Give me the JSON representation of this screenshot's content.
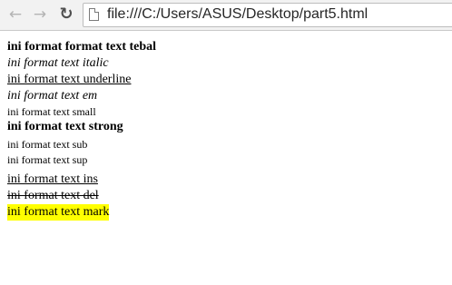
{
  "browser": {
    "back_icon": "arrow-left-icon",
    "forward_icon": "arrow-right-icon",
    "reload_icon": "reload-icon",
    "page_icon": "page-icon",
    "url": "file:///C:/Users/ASUS/Desktop/part5.html"
  },
  "page": {
    "lines": [
      {
        "text": "ini format format text tebal",
        "style": "bold"
      },
      {
        "text": "ini format text italic",
        "style": "italic"
      },
      {
        "text": "ini format text underline",
        "style": "underline"
      },
      {
        "text": "ini format text em",
        "style": "em"
      },
      {
        "text": "ini format text small",
        "style": "small"
      },
      {
        "text": "ini format text strong",
        "style": "strong"
      },
      {
        "text": "ini format text sub",
        "style": "sub"
      },
      {
        "text": "ini format text sup",
        "style": "sup"
      },
      {
        "text": "ini format text ins",
        "style": "ins"
      },
      {
        "text": "ini format text del",
        "style": "del"
      },
      {
        "text": "ini format text mark",
        "style": "mark"
      }
    ],
    "mark_color": "#ffff00"
  }
}
